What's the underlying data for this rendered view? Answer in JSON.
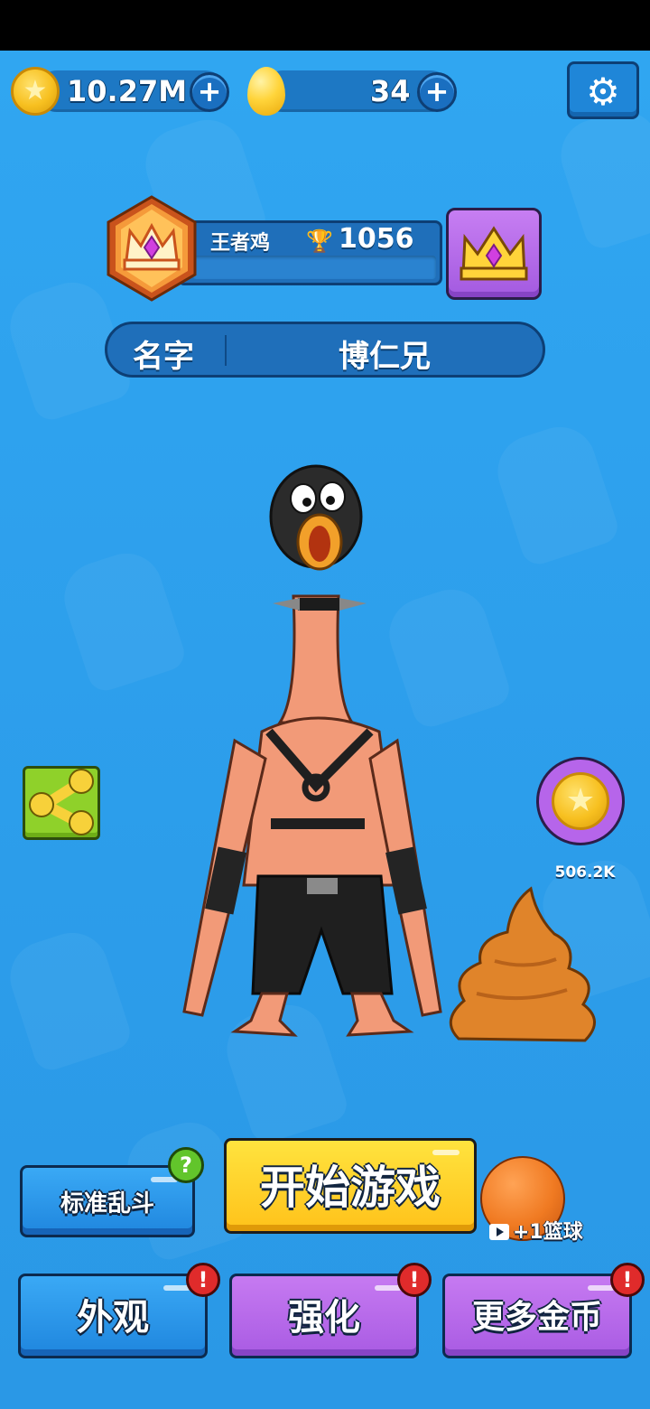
{
  "currency": {
    "coins": "10.27M",
    "eggs": "34"
  },
  "rank": {
    "title": "王者鸡",
    "trophies": "1056"
  },
  "profile": {
    "name_label": "名字",
    "name_value": "博仁兄"
  },
  "reward": {
    "coins": "506.2K"
  },
  "buttons": {
    "mode": "标准乱斗",
    "start": "开始游戏",
    "look": "外观",
    "upgrade": "强化",
    "more_coins": "更多金币"
  },
  "basketball": {
    "label": "+1篮球"
  },
  "badges": {
    "help": "?",
    "alert": "!"
  },
  "colors": {
    "background": "#2ea4f0",
    "start_button": "#ffd22c",
    "purple_button": "#b86bea",
    "blue_button": "#2b95e8"
  },
  "icons": [
    "star-coin-icon",
    "egg-icon",
    "plus-icon",
    "gear-icon",
    "crown-icon",
    "trophy-icon",
    "share-icon",
    "video-icon"
  ]
}
